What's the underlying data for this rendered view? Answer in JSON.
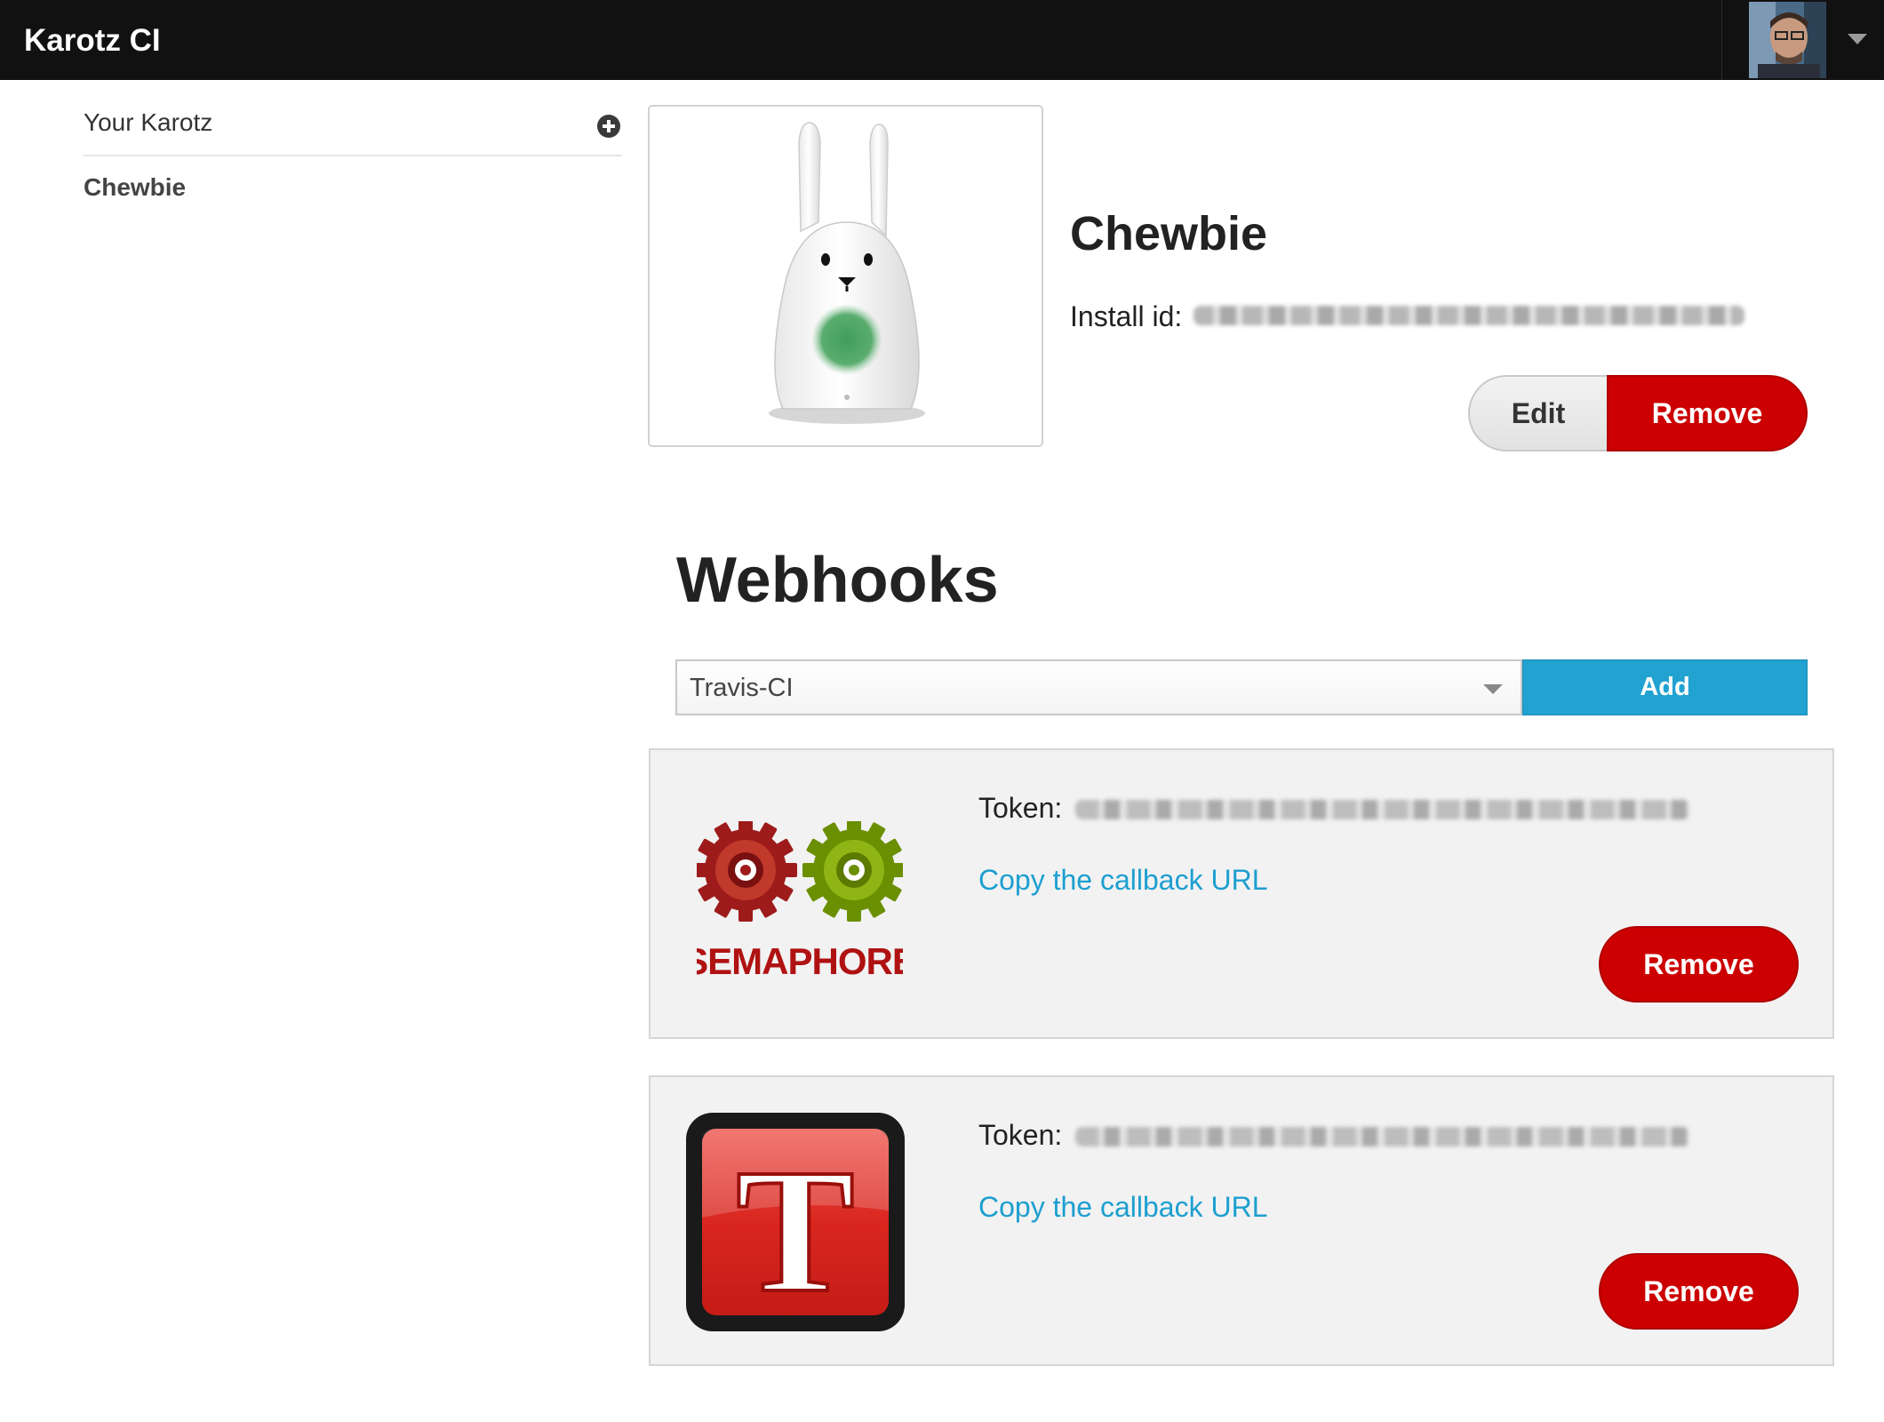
{
  "app": {
    "title": "Karotz CI"
  },
  "user": {
    "avatar": "avatar-photo",
    "menu_icon": "caret-down-icon"
  },
  "sidebar": {
    "header": "Your Karotz",
    "add_icon": "plus-circle-icon",
    "items": [
      {
        "label": "Chewbie"
      }
    ]
  },
  "device": {
    "name": "Chewbie",
    "install_label": "Install id:",
    "edit_label": "Edit",
    "remove_label": "Remove"
  },
  "webhooks": {
    "title": "Webhooks",
    "select_value": "Travis-CI",
    "add_label": "Add",
    "items": [
      {
        "service": "Semaphore",
        "logo_text": "SEMAPHORE",
        "token_label": "Token:",
        "link_label": "Copy the callback URL",
        "remove_label": "Remove"
      },
      {
        "service": "Travis-CI",
        "logo_text": "T",
        "token_label": "Token:",
        "link_label": "Copy the callback URL",
        "remove_label": "Remove"
      }
    ]
  },
  "colors": {
    "topbar": "#111111",
    "accent_blue": "#21a2d1",
    "danger_red": "#cc0000",
    "link": "#1d9fd0",
    "panel_bg": "#f2f2f2"
  }
}
